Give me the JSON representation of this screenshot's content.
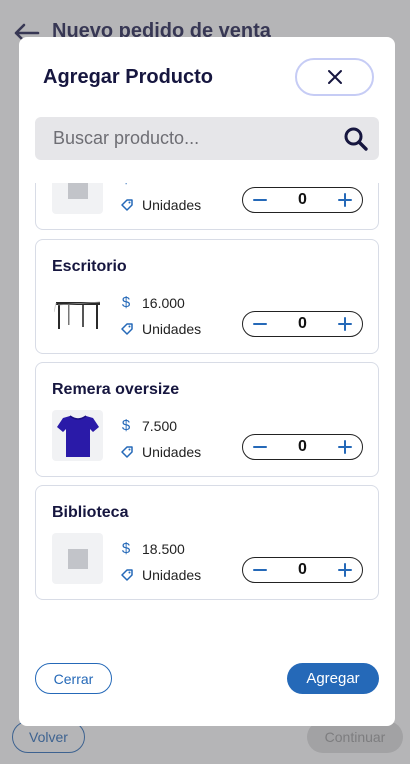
{
  "background_page": {
    "title": "Nuevo pedido de venta",
    "back_label": "Volver",
    "continue_label": "Continuar"
  },
  "modal": {
    "title": "Agregar Producto",
    "search_placeholder": "Buscar producto...",
    "close_label": "Cerrar",
    "add_label": "Agregar"
  },
  "products": [
    {
      "name": "",
      "currency": "$",
      "price": "",
      "unit": "Unidades",
      "quantity": "0",
      "image": "placeholder"
    },
    {
      "name": "Escritorio",
      "currency": "$",
      "price": "16.000",
      "unit": "Unidades",
      "quantity": "0",
      "image": "desk"
    },
    {
      "name": "Remera oversize",
      "currency": "$",
      "price": "7.500",
      "unit": "Unidades",
      "quantity": "0",
      "image": "tshirt"
    },
    {
      "name": "Biblioteca",
      "currency": "$",
      "price": "18.500",
      "unit": "Unidades",
      "quantity": "0",
      "image": "placeholder"
    }
  ],
  "colors": {
    "accent": "#2569b8",
    "title": "#16163f",
    "close_border": "#c6ccf5"
  },
  "icons": {
    "back": "arrow-left-icon",
    "close": "close-icon",
    "search": "search-icon",
    "minus": "minus-icon",
    "plus": "plus-icon",
    "unit": "tag-icon"
  }
}
